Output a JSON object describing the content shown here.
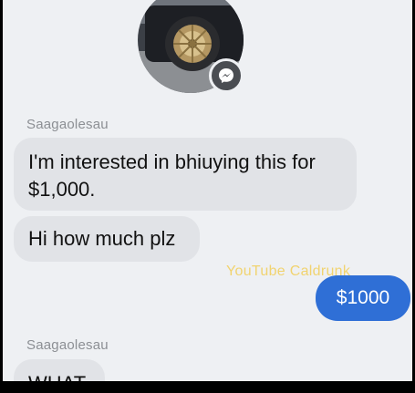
{
  "conversation": {
    "messages": [
      {
        "sender": "Saagaolesau",
        "text": "I'm interested in bhiuying this for $1,000."
      },
      {
        "text": "Hi how much plz"
      },
      {
        "outgoing_text": "$1000"
      },
      {
        "sender": "Saagaolesau",
        "text": "WHAT"
      }
    ]
  },
  "watermark": "YouTube Caldrunk",
  "colors": {
    "outgoing_bubble": "#2f6fd6",
    "incoming_bubble": "#e1e3e7",
    "background": "#eef0f3"
  },
  "icons": {
    "avatar": "profile-photo-car-wheel",
    "badge": "messenger-badge-icon"
  }
}
